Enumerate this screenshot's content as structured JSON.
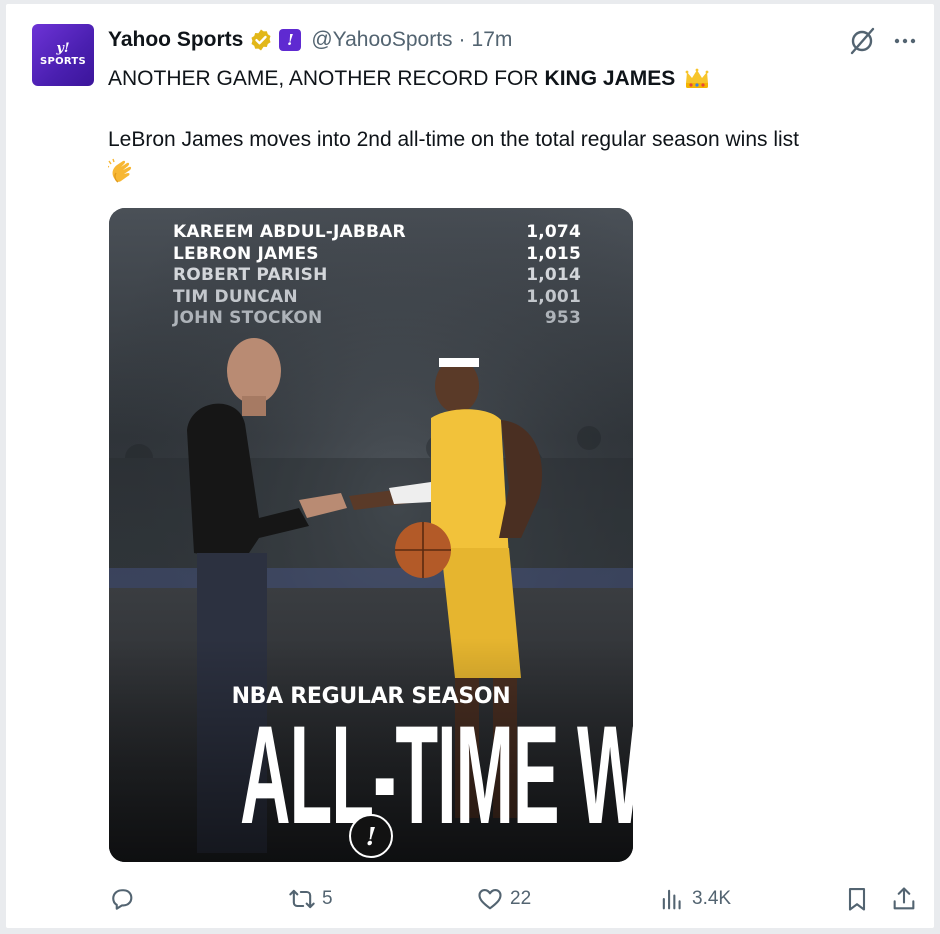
{
  "post": {
    "author_name": "Yahoo Sports",
    "handle": "@YahooSports",
    "separator": "·",
    "time": "17m",
    "avatar": {
      "line1": "y!",
      "line2": "SPORTS"
    },
    "affiliate_badge": "!",
    "text_line1_normal": "ANOTHER GAME, ANOTHER RECORD FOR",
    "text_line1_bold": "KING JAMES",
    "text_line2": "LeBron James moves into 2nd all-time on the total regular season wins list",
    "icons": {
      "verified": "verified-badge-icon",
      "crown": "crown-emoji",
      "clap": "clapping-hands-emoji",
      "grok": "grok-icon",
      "more": "more-icon"
    }
  },
  "media": {
    "rankings": [
      {
        "name": "Kareem Abdul-Jabbar",
        "wins": "1,074",
        "color": "#ffffff"
      },
      {
        "name": "LeBron James",
        "wins": "1,015",
        "color": "#ffffff"
      },
      {
        "name": "Robert Parish",
        "wins": "1,014",
        "color": "#d3d6da"
      },
      {
        "name": "Tim Duncan",
        "wins": "1,001",
        "color": "#c3c7cc"
      },
      {
        "name": "John Stockon",
        "wins": "953",
        "color": "#aeb3b9"
      }
    ],
    "subtitle": "NBA REGULAR SEASON",
    "headline": "ALL-TIME WINS",
    "badge": "!"
  },
  "actions": {
    "reply_count": "",
    "retweet_count": "5",
    "like_count": "22",
    "views_count": "3.4K"
  },
  "colors": {
    "muted": "#536471",
    "affiliate_purple": "#5f2ad1",
    "lakers_gold": "#f2c23a",
    "lakers_purple": "#4b2a83"
  }
}
